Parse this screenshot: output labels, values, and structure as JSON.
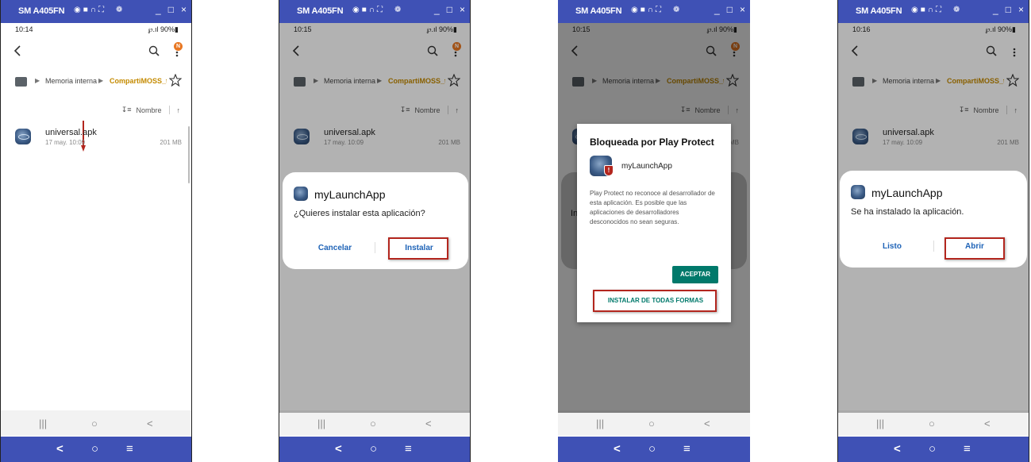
{
  "window": {
    "title": "SM A405FN",
    "tool_icons": [
      "camera-icon",
      "video-icon",
      "headset-icon",
      "fullscreen-icon",
      "settings-icon"
    ],
    "controls": [
      "_",
      "□",
      "×"
    ]
  },
  "file_browser": {
    "breadcrumb": [
      "Memoria interna",
      "CompartiMOSS_te"
    ],
    "sort_label": "Nombre",
    "file": {
      "name": "universal.apk",
      "date": "17 may. 10:09",
      "size": "201 MB"
    },
    "notification_badge": "N"
  },
  "status_bar": {
    "battery": "90%"
  },
  "nav": {
    "recent": "|||",
    "home": "○",
    "back": "<"
  },
  "bottom_bar": {
    "back": "<",
    "home": "○",
    "menu": "≡"
  },
  "panels": [
    {
      "time": "10:14"
    },
    {
      "time": "10:15",
      "dialog": {
        "app_name": "myLaunchApp",
        "question": "¿Quieres instalar esta aplicación?",
        "cancel": "Cancelar",
        "install": "Instalar"
      }
    },
    {
      "time": "10:15",
      "play_protect": {
        "title": "Bloqueada por Play Protect",
        "app_name": "myLaunchApp",
        "message": "Play Protect no reconoce al desarrollador de esta aplicación. Es posible que las aplicaciones de desarrolladores desconocidos no sean seguras.",
        "accept": "ACEPTAR",
        "install_anyway": "INSTALAR DE TODAS FORMAS"
      },
      "behind_fragment": "In"
    },
    {
      "time": "10:16",
      "dialog": {
        "app_name": "myLaunchApp",
        "message": "Se ha instalado la aplicación.",
        "done": "Listo",
        "open": "Abrir"
      }
    }
  ]
}
